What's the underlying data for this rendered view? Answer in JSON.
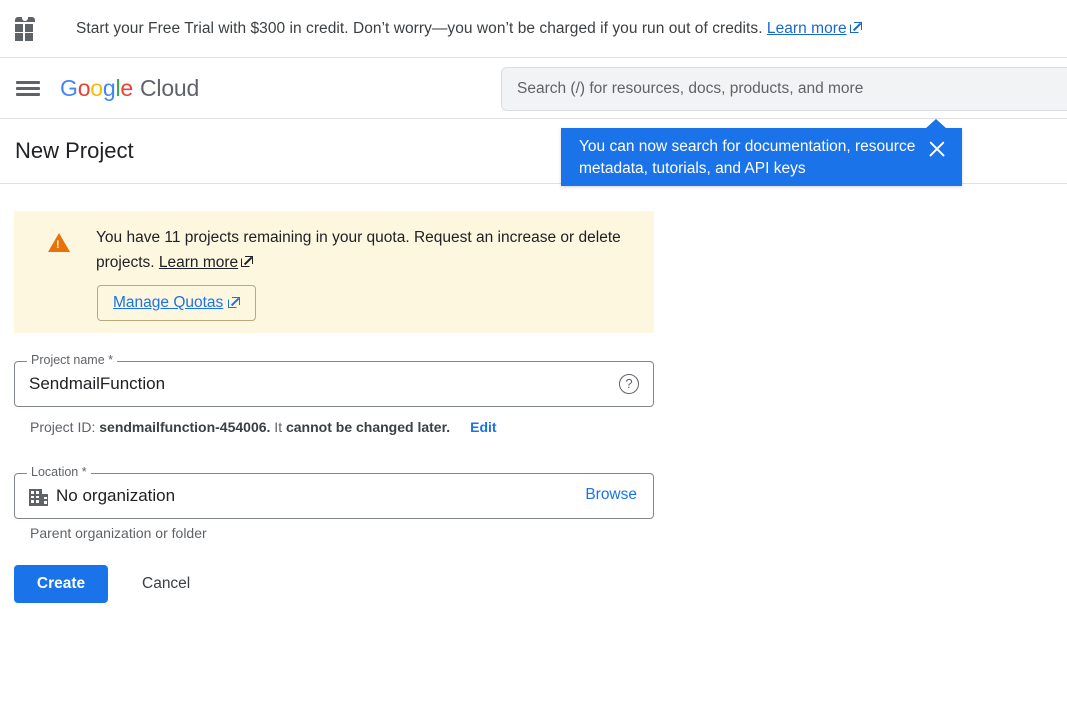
{
  "promo": {
    "icon": "gift-icon",
    "text": "Start your Free Trial with $300 in credit. Don’t worry—you won’t be charged if you run out of credits.",
    "link_label": "Learn more"
  },
  "header": {
    "menu_icon": "hamburger-menu-icon",
    "brand_google": [
      "G",
      "o",
      "o",
      "g",
      "l",
      "e"
    ],
    "brand_suffix": "Cloud",
    "search_placeholder": "Search (/) for resources, docs, products, and more"
  },
  "page": {
    "title": "New Project"
  },
  "callout": {
    "message": "You can now search for documentation, resource metadata, tutorials, and API keys",
    "close_icon": "close-icon",
    "background": "#1a73e8"
  },
  "warning": {
    "icon": "warning-triangle-icon",
    "text_part1": "You have 11 projects remaining in your quota. Request an increase or delete projects. ",
    "link_label": "Learn more",
    "button_label": "Manage Quotas",
    "background": "#fef7e0",
    "icon_color": "#e8710a"
  },
  "form": {
    "project_name": {
      "label": "Project name *",
      "value": "SendmailFunction",
      "help_icon": "help-circle-icon"
    },
    "project_id": {
      "prefix": "Project ID: ",
      "id": "sendmailfunction-454006.",
      "middle": " It ",
      "suffix": "cannot be changed later.",
      "edit_label": "Edit"
    },
    "location": {
      "label": "Location *",
      "value": "No organization",
      "icon": "organization-building-icon",
      "browse_label": "Browse",
      "hint": "Parent organization or folder"
    }
  },
  "actions": {
    "create_label": "Create",
    "cancel_label": "Cancel",
    "primary_color": "#1a73e8"
  }
}
